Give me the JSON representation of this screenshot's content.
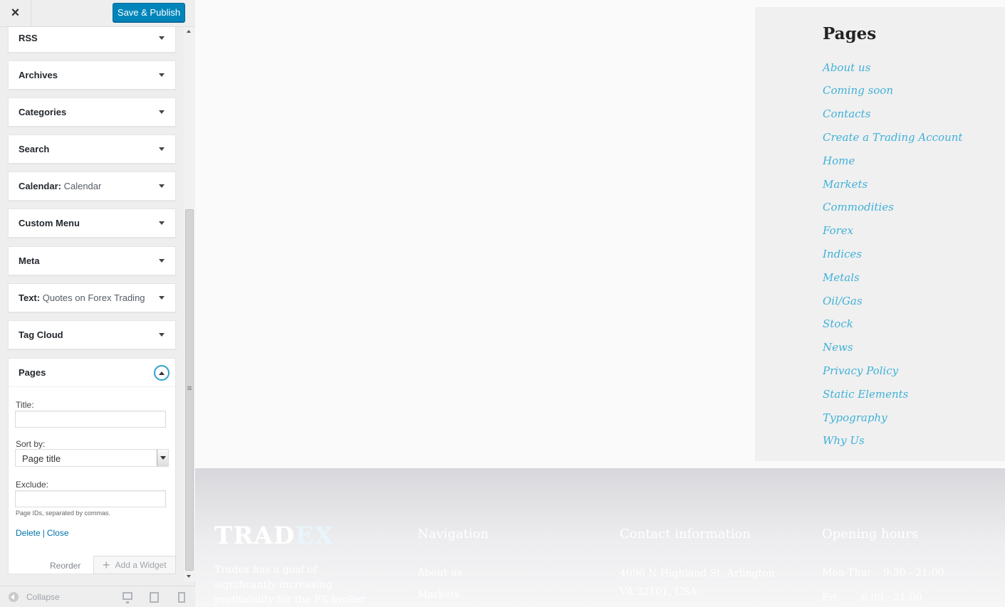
{
  "topbar": {
    "close_glyph": "×",
    "save_label": "Save & Publish"
  },
  "widgets": [
    {
      "label": "RSS",
      "instance": ""
    },
    {
      "label": "Archives",
      "instance": ""
    },
    {
      "label": "Categories",
      "instance": ""
    },
    {
      "label": "Search",
      "instance": ""
    },
    {
      "label": "Calendar:",
      "instance": "Calendar"
    },
    {
      "label": "Custom Menu",
      "instance": ""
    },
    {
      "label": "Meta",
      "instance": ""
    },
    {
      "label": "Text:",
      "instance": "Quotes on Forex Trading"
    },
    {
      "label": "Tag Cloud",
      "instance": ""
    }
  ],
  "pages_widget": {
    "label": "Pages",
    "title_label": "Title:",
    "title_value": "",
    "sort_label": "Sort by:",
    "sort_value": "Page title",
    "exclude_label": "Exclude:",
    "exclude_value": "",
    "exclude_hint": "Page IDs, separated by commas.",
    "delete_label": "Delete",
    "separator": "|",
    "close_label": "Close"
  },
  "sidebar_footer": {
    "reorder_label": "Reorder",
    "add_widget_label": "Add a Widget",
    "plus_glyph": "+",
    "collapse_label": "Collapse"
  },
  "preview": {
    "pages_title": "Pages",
    "pages_links": [
      "About us",
      "Coming soon",
      "Contacts",
      "Create a Trading Account",
      "Home",
      "Markets",
      "Commodities",
      "Forex",
      "Indices",
      "Metals",
      "Oil/Gas",
      "Stock",
      "News",
      "Privacy Policy",
      "Static Elements",
      "Typography",
      "Why Us"
    ],
    "footer": {
      "brand_part1": "TRAD",
      "brand_part2": "EX",
      "about_lines": [
        "Tradex has a goal of",
        "significantly increasing",
        "profitability for the FX broker"
      ],
      "nav_title": "Navigation",
      "nav_items": [
        "About us",
        "Markets"
      ],
      "contact_title": "Contact information",
      "contact_lines": [
        "4096 N Highland St, Arlington",
        "VA 32101, USA"
      ],
      "hours_title": "Opening hours",
      "hours_rows": [
        {
          "day": "Mon-Thu:",
          "time": "9:30 - 21:00"
        },
        {
          "day": "Fri:",
          "time": "6:00 - 21:00"
        }
      ]
    }
  },
  "colors": {
    "primary_button": "#0085ba",
    "link": "#3fb1d8",
    "focus_ring": "#2ea2cc"
  }
}
